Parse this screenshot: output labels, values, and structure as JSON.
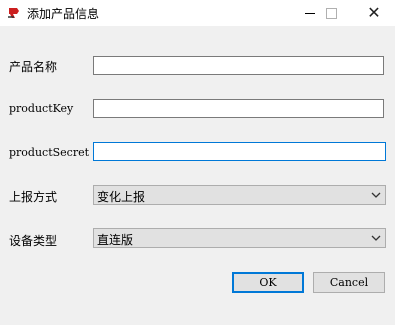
{
  "window": {
    "title": "添加产品信息",
    "close_glyph": "✕"
  },
  "form": {
    "product_name_label": "产品名称",
    "product_name_value": "",
    "product_key_label": "productKey",
    "product_key_value": "",
    "product_secret_label": "productSecret",
    "product_secret_value": "",
    "report_method_label": "上报方式",
    "report_method_value": "变化上报",
    "device_type_label": "设备类型",
    "device_type_value": "直连版"
  },
  "buttons": {
    "ok_label": "OK",
    "cancel_label": "Cancel"
  },
  "colors": {
    "focus_accent": "#0078d7",
    "icon_red": "#cc1f1f"
  },
  "icons": {
    "app": "app-logo-icon",
    "minimize": "minimize-icon",
    "maximize": "maximize-icon",
    "close": "close-icon",
    "dropdown": "chevron-down-icon"
  }
}
